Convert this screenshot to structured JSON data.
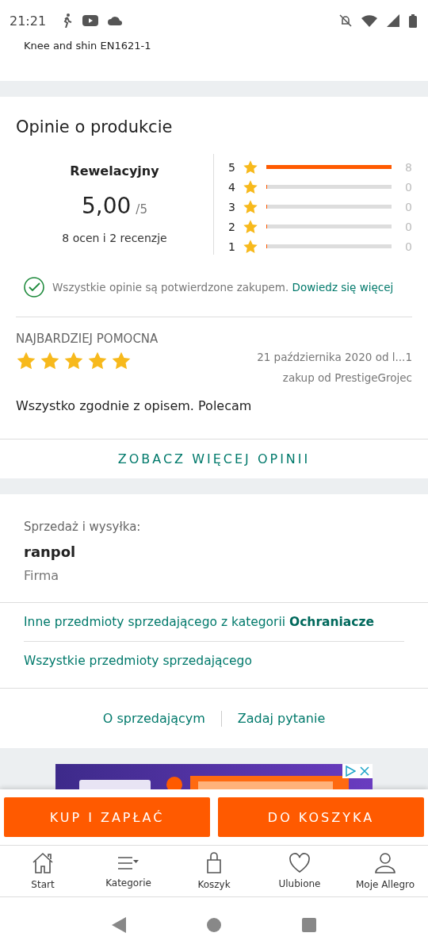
{
  "status_bar": {
    "time": "21:21"
  },
  "product_title_fragment": "Knee and shin EN1621-1",
  "reviews": {
    "title": "Opinie o produkcie",
    "verdict": "Rewelacyjny",
    "score": "5,00",
    "score_max": "/5",
    "summary": "8 ocen i 2 recenzje",
    "distribution": [
      {
        "stars_label": "5",
        "level": 1,
        "count": "8"
      },
      {
        "stars_label": "4",
        "level": 0,
        "count": "0"
      },
      {
        "stars_label": "3",
        "level": 0,
        "count": "0"
      },
      {
        "stars_label": "2",
        "level": 0,
        "count": "0"
      },
      {
        "stars_label": "1",
        "level": 0,
        "count": "0"
      }
    ],
    "verified_note": "Wszystkie opinie są potwierdzone zakupem.",
    "verified_link": "Dowiedz się więcej",
    "top_review": {
      "heading": "NAJBARDZIEJ POMOCNA",
      "stars": 5,
      "date": "21 października 2020 od l...1",
      "purchase": "zakup od PrestigeGrojec",
      "text": "Wszystko zgodnie z opisem. Polecam"
    },
    "more_button": "ZOBACZ WIĘCEJ OPINII"
  },
  "seller": {
    "label": "Sprzedaż i wysyłka:",
    "name": "ranpol",
    "type": "Firma",
    "links": [
      "Inne przedmioty sprzedającego z kategorii **Ochraniacze**",
      "Wszystkie przedmioty sprzedającego"
    ],
    "actions": [
      "O sprzedającym",
      "Zadaj pytanie"
    ]
  },
  "buy_buttons": [
    "KUP I ZAPŁAĆ",
    "DO KOSZYKA"
  ],
  "tab_bar": [
    {
      "kind": "home",
      "label": "Start"
    },
    {
      "kind": "categories",
      "label": "Kategorie"
    },
    {
      "kind": "cart",
      "label": "Koszyk"
    },
    {
      "kind": "heart",
      "label": "Ulubione"
    },
    {
      "kind": "user",
      "label": "Moje Allegro"
    }
  ]
}
